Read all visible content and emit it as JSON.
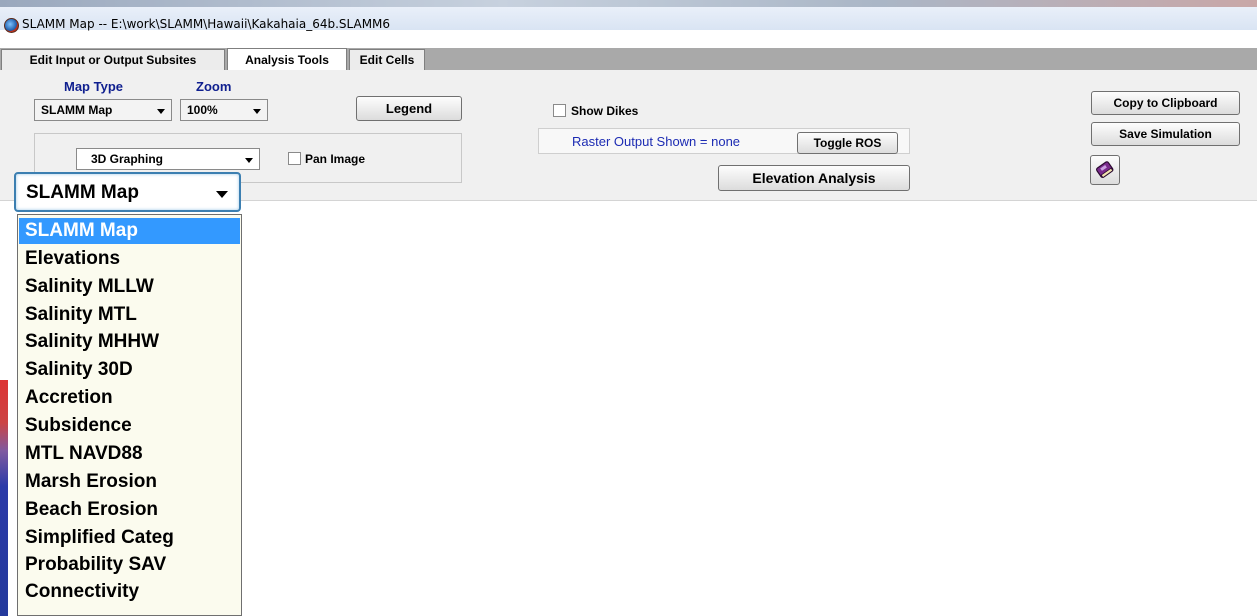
{
  "window": {
    "title": "SLAMM Map -- E:\\work\\SLAMM\\Hawaii\\Kakahaia_64b.SLAMM6"
  },
  "tabs": [
    {
      "label": "Edit Input or Output Subsites",
      "active": false
    },
    {
      "label": "Analysis Tools",
      "active": true
    },
    {
      "label": "Edit Cells",
      "active": false
    }
  ],
  "tools": {
    "map_type_label": "Map Type",
    "zoom_label": "Zoom",
    "map_type_value": "SLAMM Map",
    "zoom_value": "100%",
    "legend_button": "Legend",
    "graphing_value": "3D Graphing",
    "pan_image_label": "Pan Image",
    "show_dikes_label": "Show Dikes",
    "raster_output_text": "Raster Output Shown = none",
    "toggle_ros_button": "Toggle ROS",
    "elevation_analysis_button": "Elevation Analysis",
    "copy_clipboard_button": "Copy to Clipboard",
    "save_simulation_button": "Save Simulation",
    "book_icon": "book-icon"
  },
  "dropdown": {
    "current": "SLAMM Map",
    "options": [
      "SLAMM Map",
      "Elevations",
      "Salinity MLLW",
      "Salinity MTL",
      "Salinity MHHW",
      "Salinity 30D",
      "Accretion",
      "Subsidence",
      "MTL NAVD88",
      "Marsh Erosion",
      "Beach Erosion",
      "Simplified Categ",
      "Probability SAV",
      "Connectivity"
    ],
    "selected_index": 0
  },
  "colors": {
    "label_blue": "#0f1f8f",
    "selection_blue": "#3399ff",
    "dropdown_bg": "#fbfbee"
  }
}
